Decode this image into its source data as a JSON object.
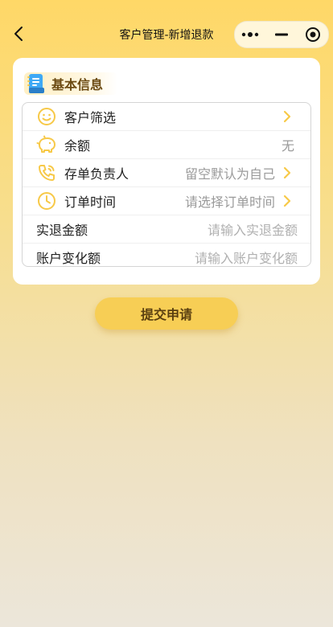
{
  "header": {
    "title": "客户管理-新增退款"
  },
  "section": {
    "title": "基本信息"
  },
  "form": {
    "customer": {
      "label": "客户筛选",
      "value": ""
    },
    "balance": {
      "label": "余额",
      "value": "无"
    },
    "owner": {
      "label": "存单负责人",
      "value": "留空默认为自己"
    },
    "order_time": {
      "label": "订单时间",
      "value": "请选择订单时间"
    },
    "refund_amount": {
      "label": "实退金额",
      "placeholder": "请输入实退金额"
    },
    "account_change": {
      "label": "账户变化额",
      "placeholder": "请输入账户变化额"
    }
  },
  "submit_label": "提交申请",
  "colors": {
    "accent": "#F7C948",
    "button": "#F7CE55",
    "section_title": "#6B4A12"
  },
  "icons": [
    "back-arrow-icon",
    "more-dots-icon",
    "minimize-icon",
    "close-target-icon",
    "notebook-icon",
    "smile-icon",
    "piggy-bank-icon",
    "phone-icon",
    "clock-icon",
    "chevron-right-icon"
  ]
}
